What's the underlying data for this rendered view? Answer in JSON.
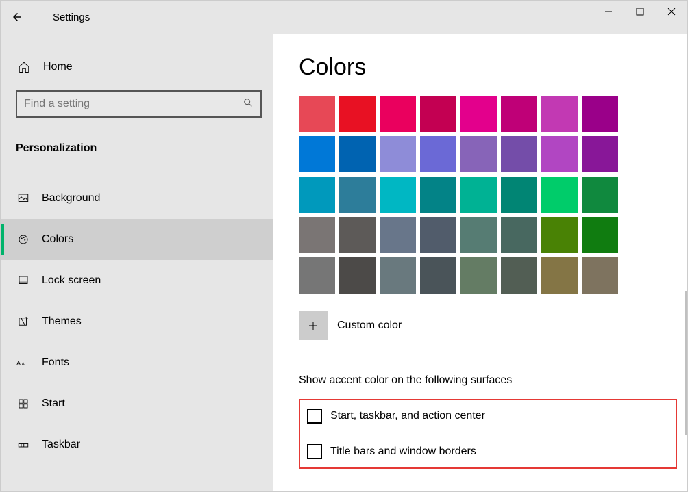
{
  "window": {
    "title": "Settings"
  },
  "home": {
    "label": "Home"
  },
  "search": {
    "placeholder": "Find a setting"
  },
  "group": {
    "title": "Personalization"
  },
  "nav": [
    {
      "label": "Background",
      "active": false
    },
    {
      "label": "Colors",
      "active": true
    },
    {
      "label": "Lock screen",
      "active": false
    },
    {
      "label": "Themes",
      "active": false
    },
    {
      "label": "Fonts",
      "active": false
    },
    {
      "label": "Start",
      "active": false
    },
    {
      "label": "Taskbar",
      "active": false
    }
  ],
  "main": {
    "heading": "Colors",
    "custom_color_label": "Custom color",
    "section_label": "Show accent color on the following surfaces",
    "check1": "Start, taskbar, and action center",
    "check2": "Title bars and window borders"
  },
  "colors": [
    "#e74856",
    "#e81123",
    "#ea005e",
    "#c30052",
    "#e3008c",
    "#bf0077",
    "#c239b3",
    "#9a0089",
    "#0078d7",
    "#0063b1",
    "#8e8cd8",
    "#6b69d6",
    "#8764b8",
    "#744da9",
    "#b146c2",
    "#881798",
    "#0099bc",
    "#2d7d9a",
    "#00b7c3",
    "#038387",
    "#00b294",
    "#018574",
    "#00cc6a",
    "#10893e",
    "#7a7574",
    "#5d5a58",
    "#68768a",
    "#515c6b",
    "#567c73",
    "#486860",
    "#498205",
    "#107c10",
    "#767676",
    "#4c4a48",
    "#69797e",
    "#4a5459",
    "#647c64",
    "#525e54",
    "#847545",
    "#7e735f"
  ]
}
